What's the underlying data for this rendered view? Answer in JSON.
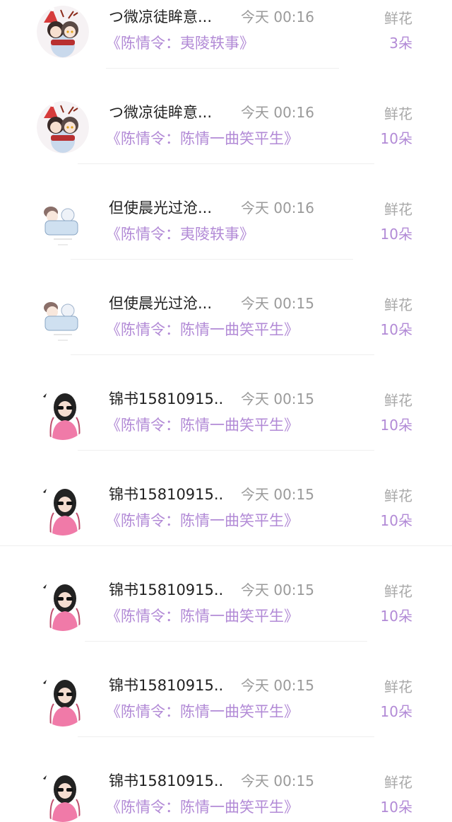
{
  "gift_label": "鲜花",
  "accent_color": "#b28ad6",
  "rows": [
    {
      "name": "つ微凉徒眸意...",
      "time": "今天 00:16",
      "book": "《陈情令：夷陵轶事》",
      "count": "3朵",
      "avatar": "couple-avatar"
    },
    {
      "name": "つ微凉徒眸意...",
      "time": "今天 00:16",
      "book": "《陈情令：陈情一曲笑平生》",
      "count": "10朵",
      "avatar": "couple-avatar"
    },
    {
      "name": "但使晨光过沧...",
      "time": "今天 00:16",
      "book": "《陈情令：夷陵轶事》",
      "count": "10朵",
      "avatar": "sketch-avatar"
    },
    {
      "name": "但使晨光过沧...",
      "time": "今天 00:15",
      "book": "《陈情令：陈情一曲笑平生》",
      "count": "10朵",
      "avatar": "sketch-avatar"
    },
    {
      "name": "锦书15810915...",
      "time": "今天 00:15",
      "book": "《陈情令：陈情一曲笑平生》",
      "count": "10朵",
      "avatar": "girl-sunglasses-avatar"
    },
    {
      "name": "锦书15810915...",
      "time": "今天 00:15",
      "book": "《陈情令：陈情一曲笑平生》",
      "count": "10朵",
      "avatar": "girl-sunglasses-avatar"
    },
    {
      "name": "锦书15810915...",
      "time": "今天 00:15",
      "book": "《陈情令：陈情一曲笑平生》",
      "count": "10朵",
      "avatar": "girl-sunglasses-avatar"
    },
    {
      "name": "锦书15810915...",
      "time": "今天 00:15",
      "book": "《陈情令：陈情一曲笑平生》",
      "count": "10朵",
      "avatar": "girl-sunglasses-avatar"
    },
    {
      "name": "锦书15810915...",
      "time": "今天 00:15",
      "book": "《陈情令：陈情一曲笑平生》",
      "count": "10朵",
      "avatar": "girl-sunglasses-avatar"
    }
  ]
}
